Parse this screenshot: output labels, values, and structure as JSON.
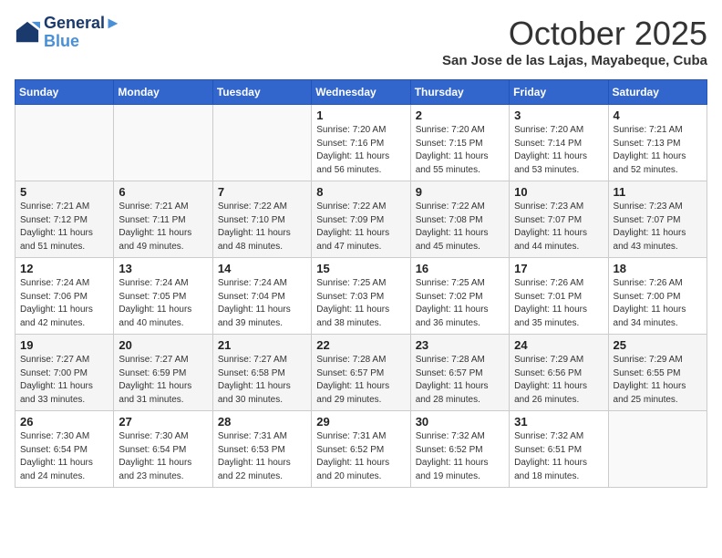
{
  "logo": {
    "line1": "General",
    "line2": "Blue"
  },
  "title": "October 2025",
  "location": "San Jose de las Lajas, Mayabeque, Cuba",
  "days_of_week": [
    "Sunday",
    "Monday",
    "Tuesday",
    "Wednesday",
    "Thursday",
    "Friday",
    "Saturday"
  ],
  "weeks": [
    [
      {
        "day": "",
        "info": ""
      },
      {
        "day": "",
        "info": ""
      },
      {
        "day": "",
        "info": ""
      },
      {
        "day": "1",
        "info": "Sunrise: 7:20 AM\nSunset: 7:16 PM\nDaylight: 11 hours and 56 minutes."
      },
      {
        "day": "2",
        "info": "Sunrise: 7:20 AM\nSunset: 7:15 PM\nDaylight: 11 hours and 55 minutes."
      },
      {
        "day": "3",
        "info": "Sunrise: 7:20 AM\nSunset: 7:14 PM\nDaylight: 11 hours and 53 minutes."
      },
      {
        "day": "4",
        "info": "Sunrise: 7:21 AM\nSunset: 7:13 PM\nDaylight: 11 hours and 52 minutes."
      }
    ],
    [
      {
        "day": "5",
        "info": "Sunrise: 7:21 AM\nSunset: 7:12 PM\nDaylight: 11 hours and 51 minutes."
      },
      {
        "day": "6",
        "info": "Sunrise: 7:21 AM\nSunset: 7:11 PM\nDaylight: 11 hours and 49 minutes."
      },
      {
        "day": "7",
        "info": "Sunrise: 7:22 AM\nSunset: 7:10 PM\nDaylight: 11 hours and 48 minutes."
      },
      {
        "day": "8",
        "info": "Sunrise: 7:22 AM\nSunset: 7:09 PM\nDaylight: 11 hours and 47 minutes."
      },
      {
        "day": "9",
        "info": "Sunrise: 7:22 AM\nSunset: 7:08 PM\nDaylight: 11 hours and 45 minutes."
      },
      {
        "day": "10",
        "info": "Sunrise: 7:23 AM\nSunset: 7:07 PM\nDaylight: 11 hours and 44 minutes."
      },
      {
        "day": "11",
        "info": "Sunrise: 7:23 AM\nSunset: 7:07 PM\nDaylight: 11 hours and 43 minutes."
      }
    ],
    [
      {
        "day": "12",
        "info": "Sunrise: 7:24 AM\nSunset: 7:06 PM\nDaylight: 11 hours and 42 minutes."
      },
      {
        "day": "13",
        "info": "Sunrise: 7:24 AM\nSunset: 7:05 PM\nDaylight: 11 hours and 40 minutes."
      },
      {
        "day": "14",
        "info": "Sunrise: 7:24 AM\nSunset: 7:04 PM\nDaylight: 11 hours and 39 minutes."
      },
      {
        "day": "15",
        "info": "Sunrise: 7:25 AM\nSunset: 7:03 PM\nDaylight: 11 hours and 38 minutes."
      },
      {
        "day": "16",
        "info": "Sunrise: 7:25 AM\nSunset: 7:02 PM\nDaylight: 11 hours and 36 minutes."
      },
      {
        "day": "17",
        "info": "Sunrise: 7:26 AM\nSunset: 7:01 PM\nDaylight: 11 hours and 35 minutes."
      },
      {
        "day": "18",
        "info": "Sunrise: 7:26 AM\nSunset: 7:00 PM\nDaylight: 11 hours and 34 minutes."
      }
    ],
    [
      {
        "day": "19",
        "info": "Sunrise: 7:27 AM\nSunset: 7:00 PM\nDaylight: 11 hours and 33 minutes."
      },
      {
        "day": "20",
        "info": "Sunrise: 7:27 AM\nSunset: 6:59 PM\nDaylight: 11 hours and 31 minutes."
      },
      {
        "day": "21",
        "info": "Sunrise: 7:27 AM\nSunset: 6:58 PM\nDaylight: 11 hours and 30 minutes."
      },
      {
        "day": "22",
        "info": "Sunrise: 7:28 AM\nSunset: 6:57 PM\nDaylight: 11 hours and 29 minutes."
      },
      {
        "day": "23",
        "info": "Sunrise: 7:28 AM\nSunset: 6:57 PM\nDaylight: 11 hours and 28 minutes."
      },
      {
        "day": "24",
        "info": "Sunrise: 7:29 AM\nSunset: 6:56 PM\nDaylight: 11 hours and 26 minutes."
      },
      {
        "day": "25",
        "info": "Sunrise: 7:29 AM\nSunset: 6:55 PM\nDaylight: 11 hours and 25 minutes."
      }
    ],
    [
      {
        "day": "26",
        "info": "Sunrise: 7:30 AM\nSunset: 6:54 PM\nDaylight: 11 hours and 24 minutes."
      },
      {
        "day": "27",
        "info": "Sunrise: 7:30 AM\nSunset: 6:54 PM\nDaylight: 11 hours and 23 minutes."
      },
      {
        "day": "28",
        "info": "Sunrise: 7:31 AM\nSunset: 6:53 PM\nDaylight: 11 hours and 22 minutes."
      },
      {
        "day": "29",
        "info": "Sunrise: 7:31 AM\nSunset: 6:52 PM\nDaylight: 11 hours and 20 minutes."
      },
      {
        "day": "30",
        "info": "Sunrise: 7:32 AM\nSunset: 6:52 PM\nDaylight: 11 hours and 19 minutes."
      },
      {
        "day": "31",
        "info": "Sunrise: 7:32 AM\nSunset: 6:51 PM\nDaylight: 11 hours and 18 minutes."
      },
      {
        "day": "",
        "info": ""
      }
    ]
  ]
}
